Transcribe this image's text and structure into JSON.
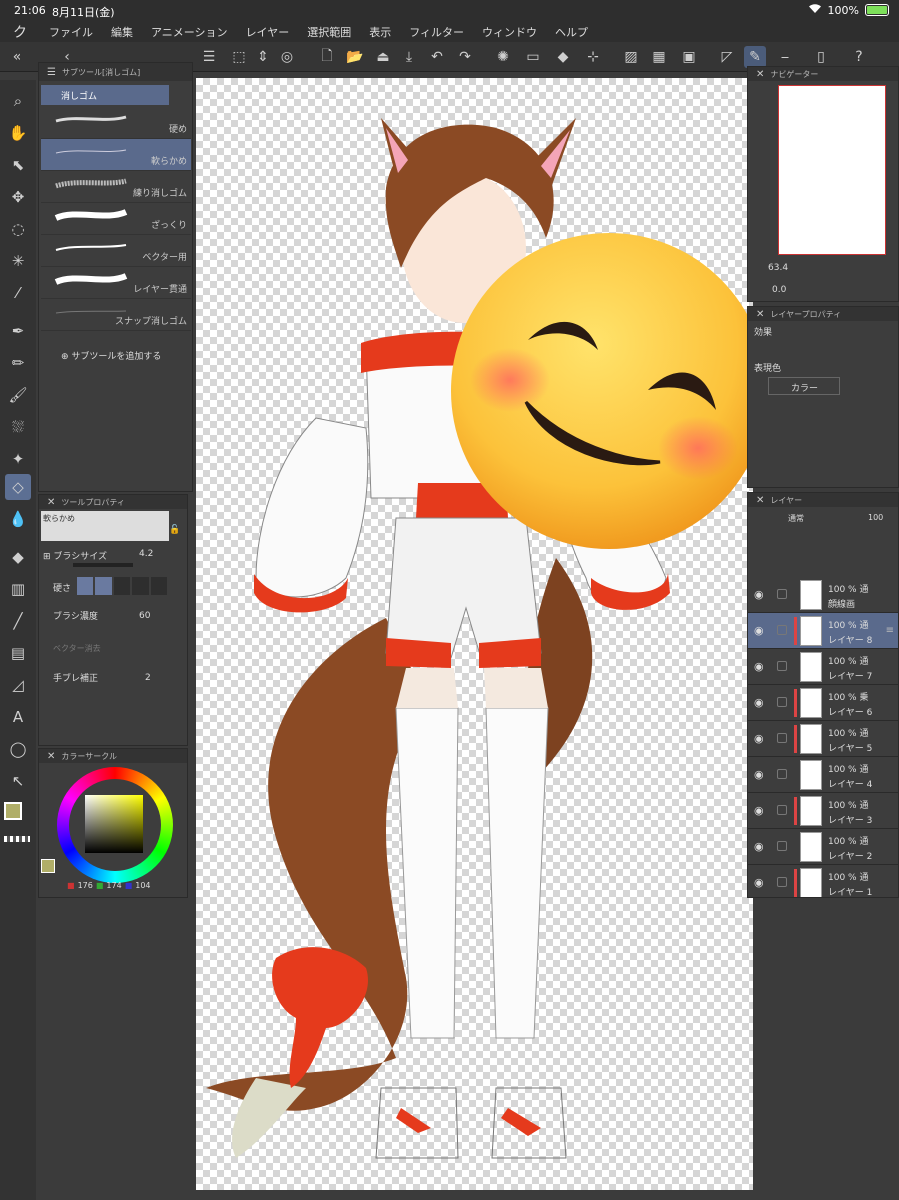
{
  "status": {
    "time": "21:06",
    "date": "8月11日(金)",
    "battery": "100%"
  },
  "menu": {
    "items": [
      "ファイル",
      "編集",
      "アニメーション",
      "レイヤー",
      "選択範囲",
      "表示",
      "フィルター",
      "ウィンドウ",
      "ヘルプ"
    ]
  },
  "subtool": {
    "tab_label": "サブツール[消しゴム]",
    "group": "消しゴム",
    "items": [
      {
        "label": "硬め"
      },
      {
        "label": "軟らかめ"
      },
      {
        "label": "練り消しゴム"
      },
      {
        "label": "ざっくり"
      },
      {
        "label": "ベクター用"
      },
      {
        "label": "レイヤー貫通"
      },
      {
        "label": "スナップ消しゴム"
      }
    ],
    "add_label": "サブツールを追加する"
  },
  "tool_property": {
    "title": "ツールプロパティ",
    "preset": "軟らかめ",
    "brush_size_label": "ブラシサイズ",
    "brush_size": "4.2",
    "hardness_label": "硬さ",
    "brush_density_label": "ブラシ濃度",
    "brush_density": "60",
    "vector_erase_label": "ベクター消去",
    "stabilization_label": "手ブレ補正",
    "stabilization": "2"
  },
  "color_circle": {
    "title": "カラーサークル",
    "r": "176",
    "g": "174",
    "b": "104",
    "current_color": "#b0ae68"
  },
  "navigator": {
    "title": "ナビゲーター",
    "zoom": "63.4",
    "rotation": "0.0"
  },
  "layer_property": {
    "title": "レイヤープロパティ",
    "effect_label": "効果",
    "display_color_label": "表現色",
    "display_color": "カラー"
  },
  "layers": {
    "title": "レイヤー",
    "blend": "通常",
    "opacity": "100",
    "rows": [
      {
        "pct": "100 % 通",
        "name": "顔線画"
      },
      {
        "pct": "100 % 通",
        "name": "レイヤー 8"
      },
      {
        "pct": "100 % 通",
        "name": "レイヤー 7"
      },
      {
        "pct": "100 % 乗",
        "name": "レイヤー 6"
      },
      {
        "pct": "100 % 通",
        "name": "レイヤー 5"
      },
      {
        "pct": "100 % 通",
        "name": "レイヤー 4"
      },
      {
        "pct": "100 % 通",
        "name": "レイヤー 3"
      },
      {
        "pct": "100 % 通",
        "name": "レイヤー 2"
      },
      {
        "pct": "100 % 通",
        "name": "レイヤー 1"
      }
    ]
  },
  "colors": {
    "accent": "#5a6a8c",
    "selected_tool": "#5c6f93"
  }
}
